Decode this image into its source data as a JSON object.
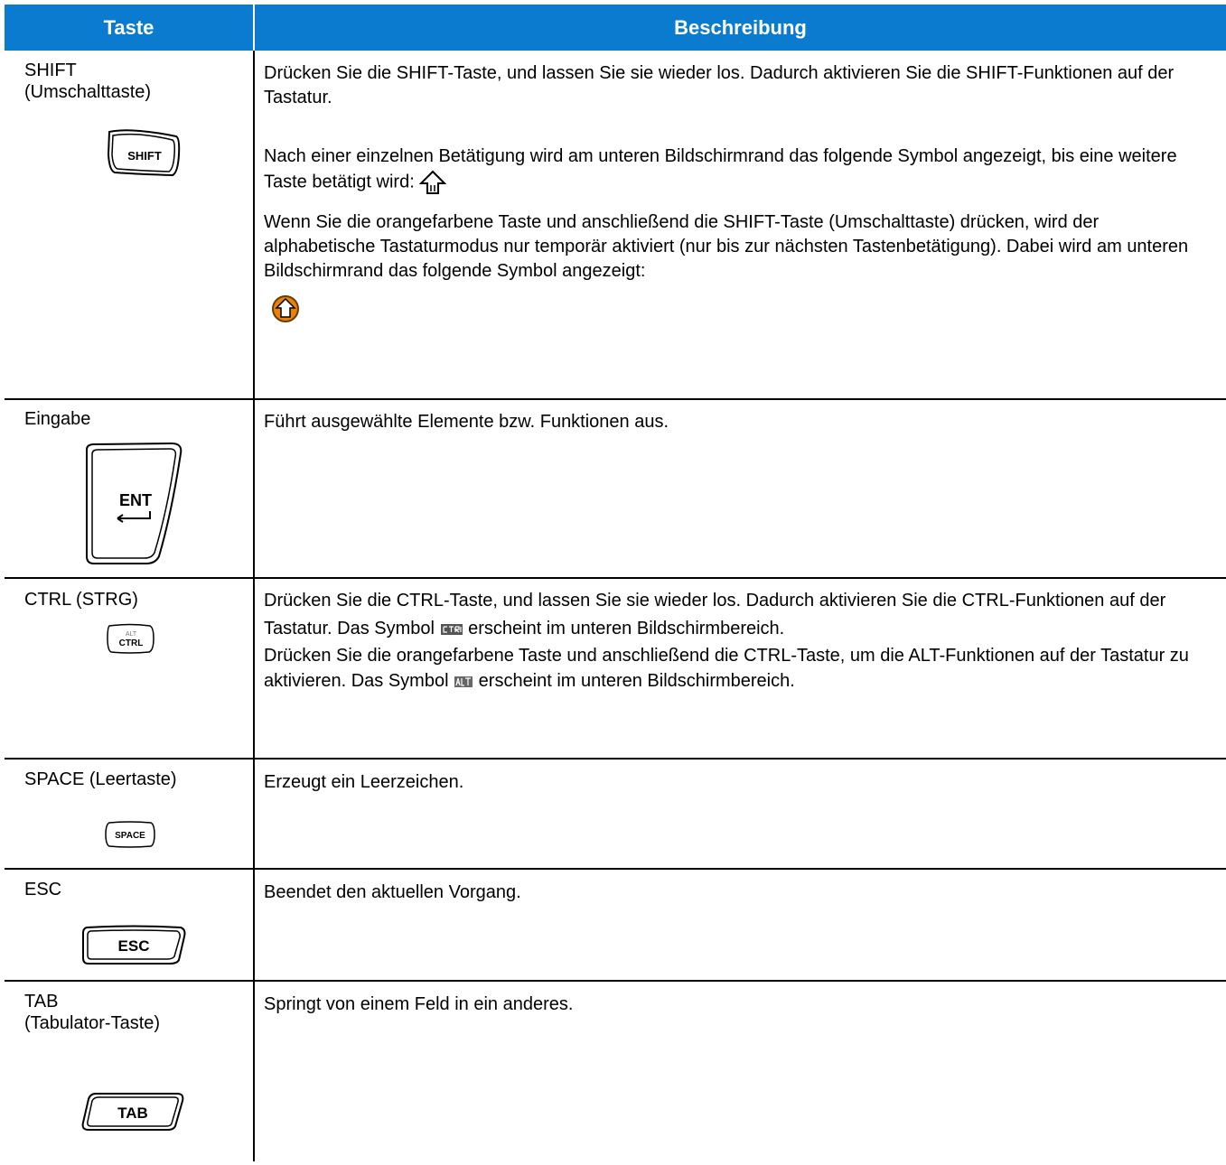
{
  "header": {
    "col1": "Taste",
    "col2": "Beschreibung"
  },
  "rows": [
    {
      "key_name": "SHIFT\n(Umschalttaste)",
      "key_cap": "SHIFT",
      "key_icon": "shift-key-icon",
      "p1": "Drücken Sie die SHIFT-Taste, und lassen Sie sie wieder los. Dadurch aktivieren Sie die SHIFT-Funktionen auf der Tastatur.",
      "p2": "Nach einer einzelnen Betätigung wird am unteren Bildschirmrand das folgende Symbol angezeigt, bis eine weitere Taste betätigt wird:",
      "p2_icon": "shift-arrow-icon",
      "p3": "Wenn Sie die orangefarbene Taste und anschließend die SHIFT-Taste (Umschalttaste) drücken, wird der alphabetische Tastaturmodus nur temporär aktiviert (nur bis zur nächsten Tastenbetätigung). Dabei wird am unteren Bildschirmrand das folgende Symbol angezeigt:",
      "p3_icon": "orange-shift-icon"
    },
    {
      "key_name": "Eingabe",
      "key_cap": "ENT",
      "key_icon": "enter-key-icon",
      "p1": "Führt ausgewählte Elemente bzw. Funktionen aus."
    },
    {
      "key_name": "CTRL (STRG)",
      "key_cap": "CTRL",
      "key_cap_alt": "ALT",
      "key_icon": "ctrl-key-icon",
      "p1a": "Drücken Sie die CTRL-Taste, und lassen Sie sie wieder los. Dadurch aktivieren Sie die CTRL-Funktionen auf der Tastatur. Das Symbol",
      "p1_icon": "ctrl-indicator-icon",
      "p1b": "erscheint im unteren Bildschirmbereich.",
      "p2a": "Drücken Sie die orangefarbene Taste und anschließend die CTRL-Taste, um die ALT-Funktionen auf der Tastatur zu aktivieren. Das Symbol",
      "p2_icon": "alt-indicator-icon",
      "p2b": "erscheint im unteren Bildschirmbereich."
    },
    {
      "key_name": "SPACE (Leertaste)",
      "key_cap": "SPACE",
      "key_icon": "space-key-icon",
      "p1": "Erzeugt ein Leerzeichen."
    },
    {
      "key_name": "ESC",
      "key_cap": "ESC",
      "key_icon": "esc-key-icon",
      "p1": "Beendet den aktuellen Vorgang."
    },
    {
      "key_name": "TAB\n(Tabulator-Taste)",
      "key_cap": "TAB",
      "key_icon": "tab-key-icon",
      "p1": "Springt von einem Feld in ein anderes."
    }
  ],
  "colors": {
    "header_bg": "#0b7bd0",
    "header_text": "#ffffff",
    "rule": "#000000",
    "orange": "#e8820c"
  }
}
